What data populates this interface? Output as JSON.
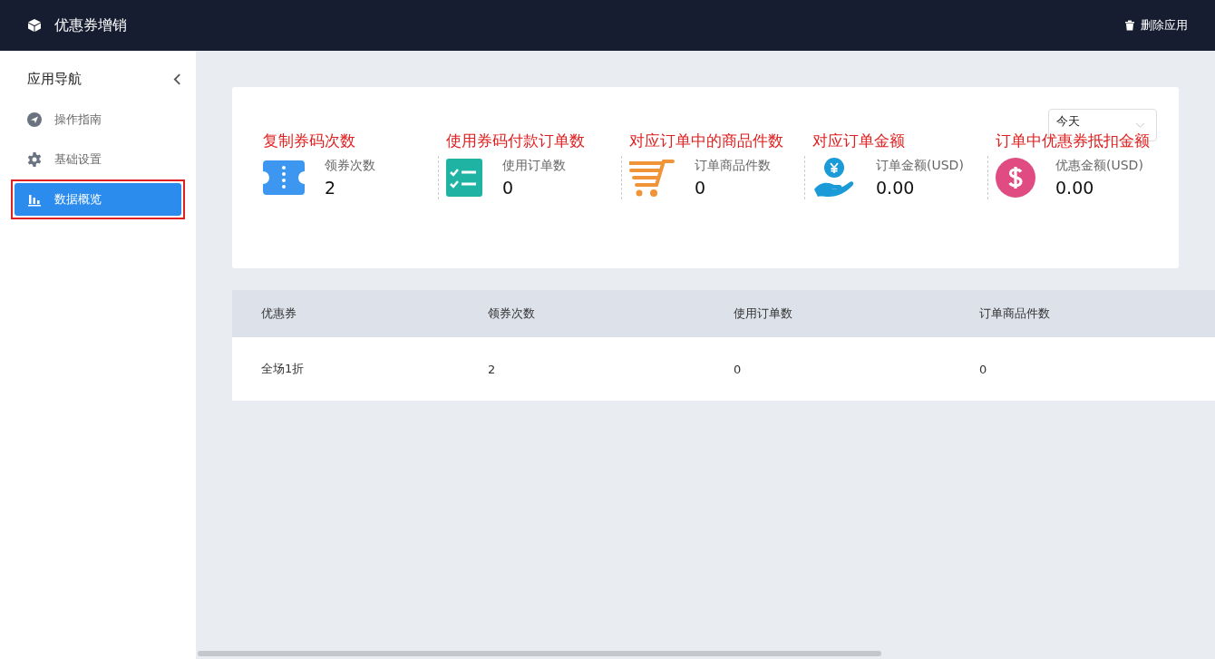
{
  "header": {
    "app_title": "优惠券增销",
    "delete_button": "删除应用"
  },
  "sidebar": {
    "title": "应用导航",
    "items": [
      {
        "label": "操作指南",
        "kind": "guide",
        "selected": false,
        "annotated": false
      },
      {
        "label": "基础设置",
        "kind": "settings",
        "selected": false,
        "annotated": false
      },
      {
        "label": "数据概览",
        "kind": "chart",
        "selected": true,
        "annotated": true
      }
    ]
  },
  "period_select": {
    "value": "今天"
  },
  "stats": [
    {
      "annotation": "复制券码次数",
      "kind": "ticket",
      "label": "领券次数",
      "value": "2"
    },
    {
      "annotation": "使用券码付款订单数",
      "kind": "checklist",
      "label": "使用订单数",
      "value": "0"
    },
    {
      "annotation": "对应订单中的商品件数",
      "kind": "cart",
      "label": "订单商品件数",
      "value": "0"
    },
    {
      "annotation": "对应订单金额",
      "kind": "hand-coin",
      "label": "订单金额(USD)",
      "value": "0.00"
    },
    {
      "annotation": "订单中优惠券抵扣金额",
      "kind": "dollar",
      "label": "优惠金额(USD)",
      "value": "0.00"
    }
  ],
  "table": {
    "columns": [
      "优惠券",
      "领券次数",
      "使用订单数",
      "订单商品件数"
    ],
    "rows": [
      [
        "全场1折",
        "2",
        "0",
        "0"
      ]
    ]
  }
}
